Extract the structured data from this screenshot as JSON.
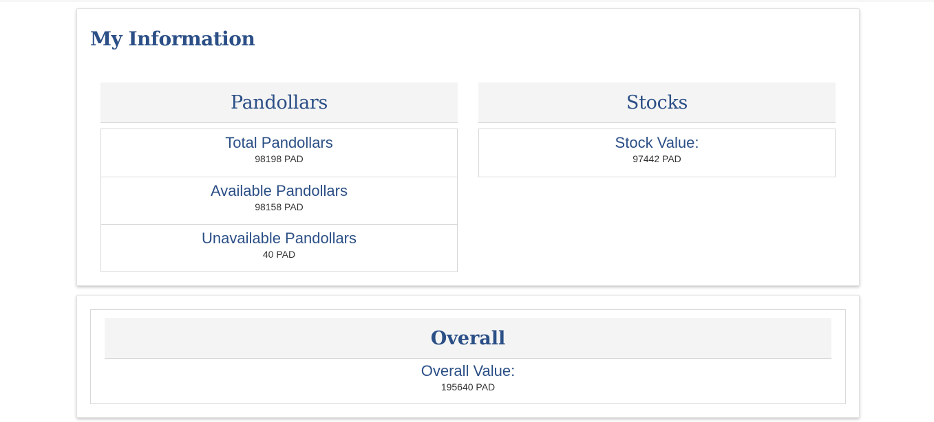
{
  "info_card": {
    "title": "My Information"
  },
  "pandollars": {
    "header": "Pandollars",
    "items": [
      {
        "label": "Total Pandollars",
        "value": "98198 PAD"
      },
      {
        "label": "Available Pandollars",
        "value": "98158 PAD"
      },
      {
        "label": "Unavailable Pandollars",
        "value": "40 PAD"
      }
    ]
  },
  "stocks": {
    "header": "Stocks",
    "items": [
      {
        "label": "Stock Value:",
        "value": "97442 PAD"
      }
    ]
  },
  "overall": {
    "header": "Overall",
    "label": "Overall Value:",
    "value": "195640 PAD"
  },
  "colors": {
    "accent": "#2b4f86",
    "header_bg": "#f4f4f4",
    "border": "#d8d8d8",
    "value_text": "#333333"
  }
}
